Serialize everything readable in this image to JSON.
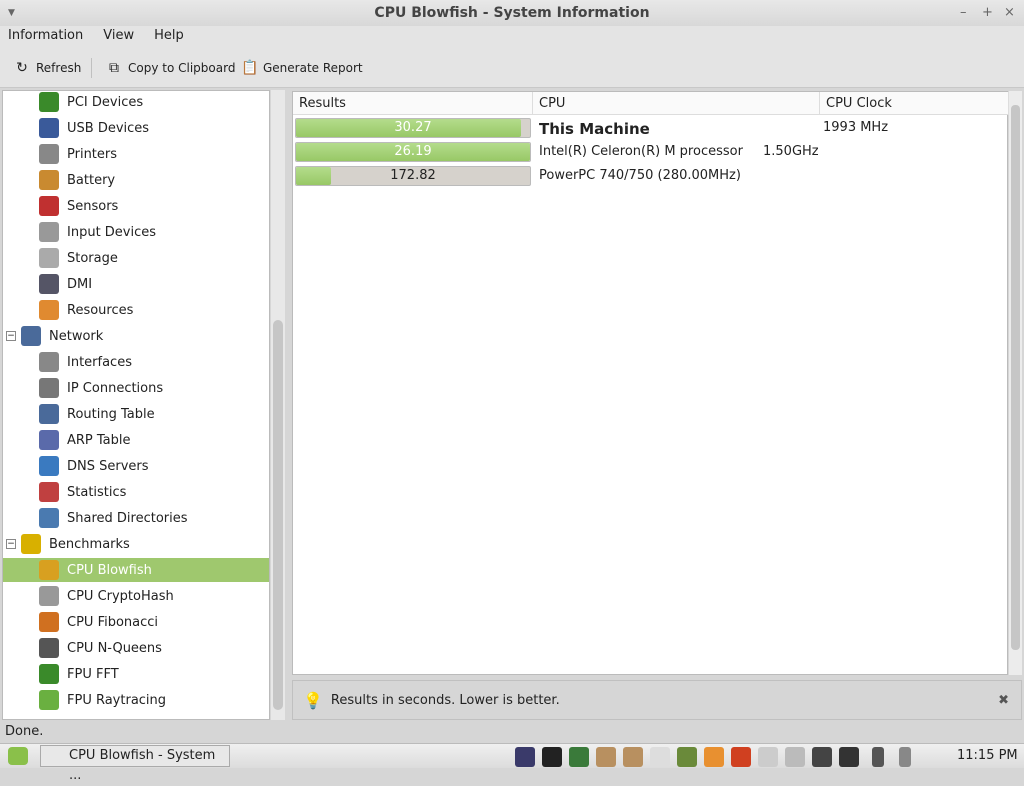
{
  "window": {
    "title": "CPU Blowfish - System Information",
    "min": "–",
    "max": "+",
    "close": "×"
  },
  "menu": [
    "Information",
    "View",
    "Help"
  ],
  "toolbar": {
    "refresh": "Refresh",
    "copy": "Copy to Clipboard",
    "report": "Generate Report"
  },
  "sidebar": [
    {
      "label": "PCI Devices",
      "indent": 1,
      "color": "#3a8a2a"
    },
    {
      "label": "USB Devices",
      "indent": 1,
      "color": "#3a5a9a"
    },
    {
      "label": "Printers",
      "indent": 1,
      "color": "#888"
    },
    {
      "label": "Battery",
      "indent": 1,
      "color": "#c98a30"
    },
    {
      "label": "Sensors",
      "indent": 1,
      "color": "#c03030"
    },
    {
      "label": "Input Devices",
      "indent": 1,
      "color": "#999"
    },
    {
      "label": "Storage",
      "indent": 1,
      "color": "#aaa"
    },
    {
      "label": "DMI",
      "indent": 1,
      "color": "#556"
    },
    {
      "label": "Resources",
      "indent": 1,
      "color": "#e08a30"
    },
    {
      "label": "Network",
      "indent": 0,
      "color": "#4a6a9a",
      "expander": "−"
    },
    {
      "label": "Interfaces",
      "indent": 1,
      "color": "#888"
    },
    {
      "label": "IP Connections",
      "indent": 1,
      "color": "#777"
    },
    {
      "label": "Routing Table",
      "indent": 1,
      "color": "#4a6a9a"
    },
    {
      "label": "ARP Table",
      "indent": 1,
      "color": "#5a6aaa"
    },
    {
      "label": "DNS Servers",
      "indent": 1,
      "color": "#3a7ac0"
    },
    {
      "label": "Statistics",
      "indent": 1,
      "color": "#c04040"
    },
    {
      "label": "Shared Directories",
      "indent": 1,
      "color": "#4a7ab0"
    },
    {
      "label": "Benchmarks",
      "indent": 0,
      "color": "#d8b000",
      "expander": "−"
    },
    {
      "label": "CPU Blowfish",
      "indent": 1,
      "color": "#d8a020",
      "selected": true
    },
    {
      "label": "CPU CryptoHash",
      "indent": 1,
      "color": "#999"
    },
    {
      "label": "CPU Fibonacci",
      "indent": 1,
      "color": "#d07020"
    },
    {
      "label": "CPU N-Queens",
      "indent": 1,
      "color": "#555"
    },
    {
      "label": "FPU FFT",
      "indent": 1,
      "color": "#3a8a2a"
    },
    {
      "label": "FPU Raytracing",
      "indent": 1,
      "color": "#6ab040"
    }
  ],
  "table": {
    "headers": [
      "Results",
      "CPU",
      "CPU Clock"
    ],
    "rows": [
      {
        "result": "30.27",
        "fill": 0.96,
        "cpu": "This Machine",
        "clock": "1993 MHz",
        "bold": true
      },
      {
        "result": "26.19",
        "fill": 1.0,
        "cpu": "Intel(R) Celeron(R) M processor",
        "clock": "1.50GHz"
      },
      {
        "result": "172.82",
        "fill": 0.15,
        "cpu": "PowerPC 740/750 (280.00MHz)",
        "clock": ""
      }
    ]
  },
  "note": "Results in seconds. Lower is better.",
  "status": "Done.",
  "taskbar": {
    "task": "CPU Blowfish - System ...",
    "clock": "11:15 PM"
  }
}
